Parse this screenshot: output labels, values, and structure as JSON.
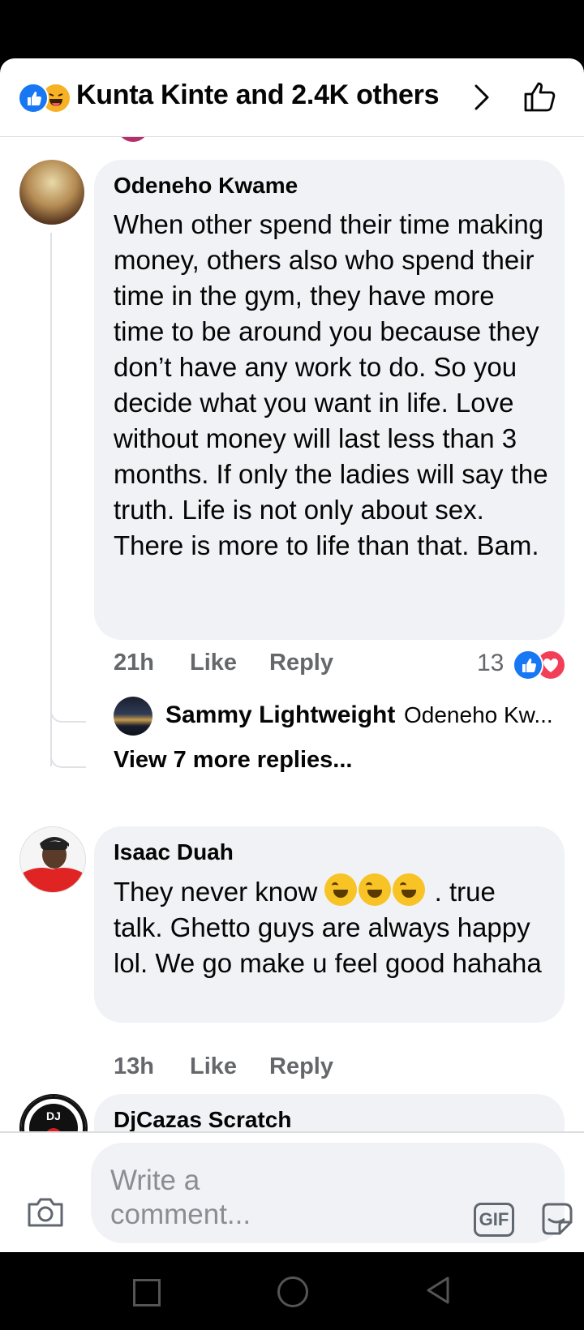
{
  "header": {
    "title": "Kunta Kinte and 2.4K others",
    "reactions": [
      "like-icon",
      "haha-icon"
    ]
  },
  "comments": [
    {
      "author": "Odeneho Kwame",
      "text": "When other spend their time making money, others also who spend their time in the gym, they have more time to be around you because they don’t have any work to do. So you decide what you want in life. Love without money will last less than 3 months. If only the ladies will say the truth. Life is not only about sex. There is more to life than that. Bam.",
      "time": "21h",
      "like_label": "Like",
      "reply_label": "Reply",
      "reaction_count": "13",
      "reply_preview": {
        "author": "Sammy Lightweight",
        "text": "Odeneho Kw..."
      },
      "more_replies": "View 7 more replies..."
    },
    {
      "author": "Isaac Duah",
      "text_before": "They never know",
      "text_after": ". true talk. Ghetto guys are always happy lol. We go make u feel good hahaha",
      "emoji": [
        "rofl-emoji",
        "rofl-emoji",
        "rofl-emoji"
      ],
      "time": "13h",
      "like_label": "Like",
      "reply_label": "Reply"
    },
    {
      "author": "DjCazas Scratch",
      "avatar_text": "DJ"
    }
  ],
  "composer": {
    "placeholder": "Write a comment...",
    "gif_label": "GIF"
  },
  "colors": {
    "accent": "#1877f2",
    "love": "#f33e58",
    "bubble": "#f0f2f5",
    "meta_text": "#65676b"
  }
}
